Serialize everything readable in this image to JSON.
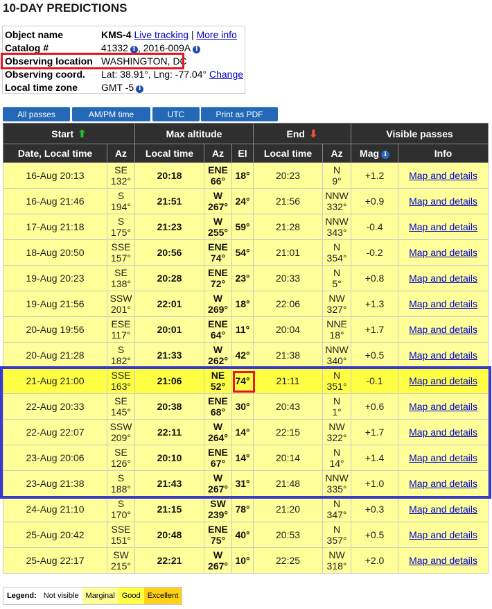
{
  "page": {
    "title": "10-DAY PREDICTIONS"
  },
  "info": {
    "object_name_label": "Object name",
    "object_name": "KMS-4",
    "live_tracking": "Live tracking",
    "separator": "|",
    "more_info": "More info",
    "catalog_label": "Catalog #",
    "catalog_value": "41332",
    "catalog_cospar": ", 2016-009A",
    "location_label": "Observing location",
    "location_value": "WASHINGTON, DC",
    "coord_label": "Observing coord.",
    "coord_value": "Lat: 38.91°, Lng: -77.04°",
    "change_link": "Change",
    "tz_label": "Local time zone",
    "tz_value": "GMT -5"
  },
  "buttons": {
    "all_passes": "All passes",
    "ampm": "AM/PM time",
    "utc": "UTC",
    "pdf": "Print as PDF"
  },
  "table": {
    "group_headers": {
      "start": "Start",
      "max_altitude": "Max altitude",
      "end": "End",
      "visible": "Visible passes"
    },
    "columns": {
      "date": "Date, Local time",
      "az1": "Az",
      "lt1": "Local time",
      "az2": "Az",
      "el": "El",
      "lt2": "Local time",
      "az3": "Az",
      "mag": "Mag",
      "info": "Info"
    },
    "rows": [
      {
        "date": "16-Aug 20:13",
        "s_dir": "SE",
        "s_deg": "132°",
        "m_time": "20:18",
        "m_dir": "ENE",
        "m_deg": "66°",
        "el": "18°",
        "e_time": "20:23",
        "e_dir": "N",
        "e_deg": "9°",
        "mag": "+1.2",
        "link": "Map and details",
        "level": "marginal"
      },
      {
        "date": "16-Aug 21:46",
        "s_dir": "S",
        "s_deg": "194°",
        "m_time": "21:51",
        "m_dir": "W",
        "m_deg": "267°",
        "el": "24°",
        "e_time": "21:56",
        "e_dir": "NNW",
        "e_deg": "332°",
        "mag": "+0.9",
        "link": "Map and details",
        "level": "marginal"
      },
      {
        "date": "17-Aug 21:18",
        "s_dir": "S",
        "s_deg": "175°",
        "m_time": "21:23",
        "m_dir": "W",
        "m_deg": "255°",
        "el": "59°",
        "e_time": "21:28",
        "e_dir": "NNW",
        "e_deg": "343°",
        "mag": "-0.4",
        "link": "Map and details",
        "level": "marginal"
      },
      {
        "date": "18-Aug 20:50",
        "s_dir": "SSE",
        "s_deg": "157°",
        "m_time": "20:56",
        "m_dir": "ENE",
        "m_deg": "74°",
        "el": "54°",
        "e_time": "21:01",
        "e_dir": "N",
        "e_deg": "354°",
        "mag": "-0.2",
        "link": "Map and details",
        "level": "marginal"
      },
      {
        "date": "19-Aug 20:23",
        "s_dir": "SE",
        "s_deg": "138°",
        "m_time": "20:28",
        "m_dir": "ENE",
        "m_deg": "72°",
        "el": "23°",
        "e_time": "20:33",
        "e_dir": "N",
        "e_deg": "5°",
        "mag": "+0.8",
        "link": "Map and details",
        "level": "marginal"
      },
      {
        "date": "19-Aug 21:56",
        "s_dir": "SSW",
        "s_deg": "201°",
        "m_time": "22:01",
        "m_dir": "W",
        "m_deg": "269°",
        "el": "18°",
        "e_time": "22:06",
        "e_dir": "NW",
        "e_deg": "327°",
        "mag": "+1.3",
        "link": "Map and details",
        "level": "marginal"
      },
      {
        "date": "20-Aug 19:56",
        "s_dir": "ESE",
        "s_deg": "117°",
        "m_time": "20:01",
        "m_dir": "ENE",
        "m_deg": "64°",
        "el": "11°",
        "e_time": "20:04",
        "e_dir": "NNE",
        "e_deg": "18°",
        "mag": "+1.7",
        "link": "Map and details",
        "level": "marginal"
      },
      {
        "date": "20-Aug 21:28",
        "s_dir": "S",
        "s_deg": "182°",
        "m_time": "21:33",
        "m_dir": "W",
        "m_deg": "262°",
        "el": "42°",
        "e_time": "21:38",
        "e_dir": "NNW",
        "e_deg": "340°",
        "mag": "+0.5",
        "link": "Map and details",
        "level": "marginal"
      },
      {
        "date": "21-Aug 21:00",
        "s_dir": "SSE",
        "s_deg": "163°",
        "m_time": "21:06",
        "m_dir": "NE",
        "m_deg": "52°",
        "el": "74°",
        "e_time": "21:11",
        "e_dir": "N",
        "e_deg": "351°",
        "mag": "-0.1",
        "link": "Map and details",
        "level": "good"
      },
      {
        "date": "22-Aug 20:33",
        "s_dir": "SE",
        "s_deg": "145°",
        "m_time": "20:38",
        "m_dir": "ENE",
        "m_deg": "68°",
        "el": "30°",
        "e_time": "20:43",
        "e_dir": "N",
        "e_deg": "1°",
        "mag": "+0.6",
        "link": "Map and details",
        "level": "marginal"
      },
      {
        "date": "22-Aug 22:07",
        "s_dir": "SSW",
        "s_deg": "209°",
        "m_time": "22:11",
        "m_dir": "W",
        "m_deg": "264°",
        "el": "14°",
        "e_time": "22:15",
        "e_dir": "NW",
        "e_deg": "322°",
        "mag": "+1.7",
        "link": "Map and details",
        "level": "marginal"
      },
      {
        "date": "23-Aug 20:06",
        "s_dir": "SE",
        "s_deg": "126°",
        "m_time": "20:10",
        "m_dir": "ENE",
        "m_deg": "67°",
        "el": "14°",
        "e_time": "20:14",
        "e_dir": "N",
        "e_deg": "14°",
        "mag": "+1.4",
        "link": "Map and details",
        "level": "marginal"
      },
      {
        "date": "23-Aug 21:38",
        "s_dir": "S",
        "s_deg": "188°",
        "m_time": "21:43",
        "m_dir": "W",
        "m_deg": "267°",
        "el": "31°",
        "e_time": "21:48",
        "e_dir": "NNW",
        "e_deg": "335°",
        "mag": "+1.0",
        "link": "Map and details",
        "level": "marginal"
      },
      {
        "date": "24-Aug 21:10",
        "s_dir": "S",
        "s_deg": "170°",
        "m_time": "21:15",
        "m_dir": "SW",
        "m_deg": "239°",
        "el": "78°",
        "e_time": "21:20",
        "e_dir": "N",
        "e_deg": "347°",
        "mag": "+0.3",
        "link": "Map and details",
        "level": "marginal"
      },
      {
        "date": "25-Aug 20:42",
        "s_dir": "SSE",
        "s_deg": "151°",
        "m_time": "20:48",
        "m_dir": "ENE",
        "m_deg": "75°",
        "el": "40°",
        "e_time": "20:53",
        "e_dir": "N",
        "e_deg": "357°",
        "mag": "+0.5",
        "link": "Map and details",
        "level": "marginal"
      },
      {
        "date": "25-Aug 22:17",
        "s_dir": "SW",
        "s_deg": "215°",
        "m_time": "22:21",
        "m_dir": "W",
        "m_deg": "267°",
        "el": "10°",
        "e_time": "22:25",
        "e_dir": "NW",
        "e_deg": "318°",
        "mag": "+2.0",
        "link": "Map and details",
        "level": "marginal"
      }
    ]
  },
  "legend": {
    "title": "Legend:",
    "not_visible": "Not visible",
    "marginal": "Marginal",
    "good": "Good",
    "excellent": "Excellent"
  },
  "colors": {
    "marginal": "#ffff99",
    "good": "#ffff44",
    "excellent": "#ffd21a",
    "header": "#2f2f2f",
    "button": "#2468b8",
    "highlight_red": "#e5161f",
    "highlight_blue": "#3a3ac8"
  },
  "icons": {
    "info": "info-icon",
    "start_arrow": "arrow-up-icon",
    "end_arrow": "arrow-down-icon"
  }
}
